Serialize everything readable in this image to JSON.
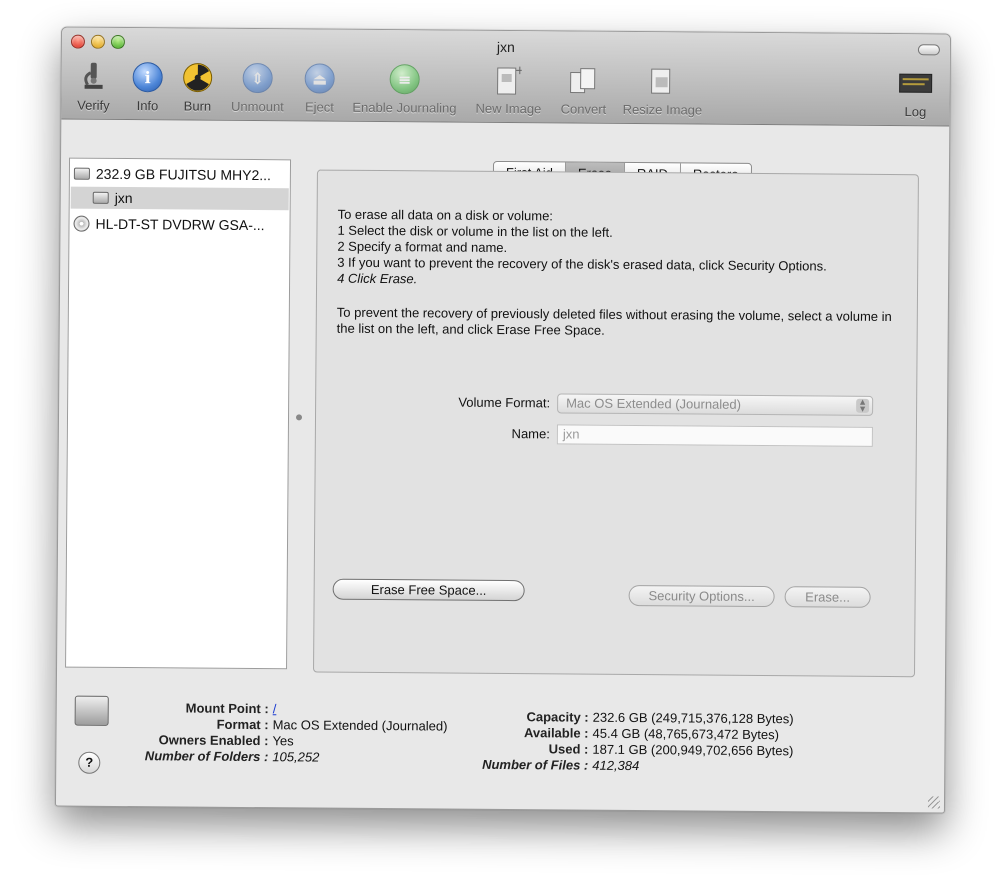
{
  "window": {
    "title": "jxn"
  },
  "toolbar": {
    "items": [
      {
        "label": "Verify",
        "icon": "microscope-icon"
      },
      {
        "label": "Info",
        "icon": "info-icon"
      },
      {
        "label": "Burn",
        "icon": "burn-icon"
      },
      {
        "label": "Unmount",
        "icon": "unmount-icon"
      },
      {
        "label": "Eject",
        "icon": "eject-icon"
      },
      {
        "label": "Enable Journaling",
        "icon": "journaling-icon"
      },
      {
        "label": "New Image",
        "icon": "new-image-icon"
      },
      {
        "label": "Convert",
        "icon": "convert-icon"
      },
      {
        "label": "Resize Image",
        "icon": "resize-image-icon"
      },
      {
        "label": "Log",
        "icon": "log-icon"
      }
    ]
  },
  "sidebar": {
    "items": [
      {
        "label": "232.9 GB FUJITSU MHY2..."
      },
      {
        "label": "jxn"
      },
      {
        "label": "HL-DT-ST DVDRW GSA-..."
      }
    ]
  },
  "tabs": [
    {
      "label": "First Aid"
    },
    {
      "label": "Erase"
    },
    {
      "label": "RAID"
    },
    {
      "label": "Restore"
    }
  ],
  "erase": {
    "intro": "To erase all data on a disk or volume:",
    "step1": "1 Select the disk or volume in the list on the left.",
    "step2": "2 Specify a format and name.",
    "step3": "3 If you want to prevent the recovery of the disk's erased data, click Security Options.",
    "step4": "4 Click Erase.",
    "free_space_note": "To prevent the recovery of previously deleted files without erasing the volume, select a volume in the list on the left, and click Erase Free Space.",
    "volume_format_label": "Volume Format:",
    "volume_format_value": "Mac OS Extended (Journaled)",
    "name_label": "Name:",
    "name_value": "jxn",
    "erase_free_space_button": "Erase Free Space...",
    "security_options_button": "Security Options...",
    "erase_button": "Erase..."
  },
  "info": {
    "mount_point_label": "Mount Point :",
    "mount_point_value": "/",
    "format_label": "Format :",
    "format_value": "Mac OS Extended (Journaled)",
    "owners_label": "Owners Enabled :",
    "owners_value": "Yes",
    "folders_label": "Number of Folders :",
    "folders_value": "105,252",
    "capacity_label": "Capacity :",
    "capacity_value": "232.6 GB (249,715,376,128 Bytes)",
    "available_label": "Available :",
    "available_value": "45.4 GB (48,765,673,472 Bytes)",
    "used_label": "Used :",
    "used_value": "187.1 GB (200,949,702,656 Bytes)",
    "files_label": "Number of Files :",
    "files_value": "412,384",
    "help_glyph": "?"
  }
}
